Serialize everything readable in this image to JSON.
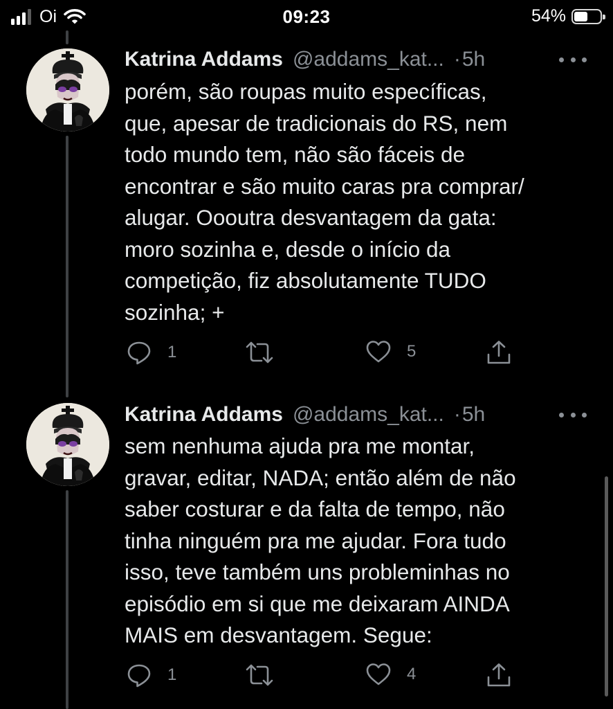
{
  "status_bar": {
    "carrier": "Oi",
    "time": "09:23",
    "battery_percent": "54%",
    "battery_level": 0.54,
    "signal_bars": 3,
    "icons": [
      "signal-icon",
      "wifi-icon",
      "battery-icon"
    ]
  },
  "tweets": [
    {
      "name": "Katrina Addams",
      "handle": "@addams_kat...",
      "separator": "·",
      "time": "5h",
      "text": "porém, são roupas muito específicas,\nque, apesar de tradicionais do RS, nem\ntodo mundo tem, não são fáceis de\nencontrar e são muito caras pra comprar/\nalugar. Oooutra desvantagem da gata:\nmoro sozinha e, desde o início da\ncompetição, fiz absolutamente TUDO\nsozinha; +",
      "replies": "1",
      "retweets": "",
      "likes": "5"
    },
    {
      "name": "Katrina Addams",
      "handle": "@addams_kat...",
      "separator": "·",
      "time": "5h",
      "text": "sem nenhuma ajuda pra me montar,\ngravar, editar, NADA; então além de não\nsaber costurar e da falta de tempo, não\ntinha ninguém pra me ajudar. Fora tudo\nisso, teve também uns probleminhas no\nepisódio em si que me deixaram AINDA\nMAIS em desvantagem. Segue:",
      "replies": "1",
      "retweets": "",
      "likes": "4"
    }
  ],
  "colors": {
    "background": "#000000",
    "text": "#e7e9ea",
    "secondary": "#8b9096",
    "thread_line": "#3e4144"
  }
}
